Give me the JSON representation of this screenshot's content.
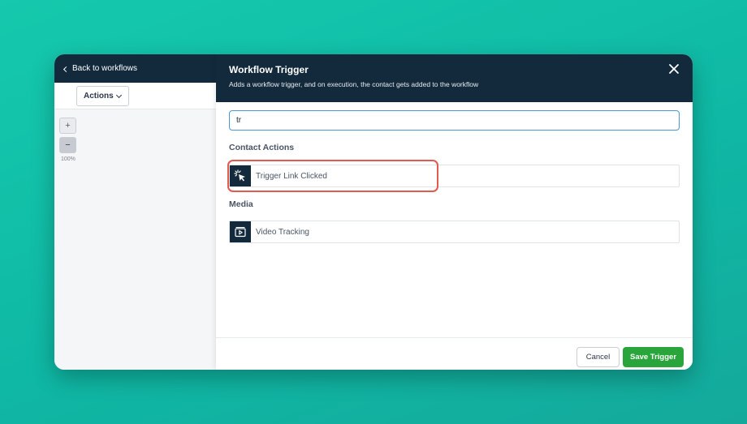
{
  "sidebar": {
    "back_label": "Back to workflows",
    "actions_label": "Actions",
    "zoom_in": "+",
    "zoom_out": "−",
    "zoom_level": "100%"
  },
  "panel": {
    "title": "Workflow Trigger",
    "description": "Adds a workflow trigger, and on execution, the contact gets added to the workflow",
    "search_value": "tr",
    "sections": [
      {
        "label": "Contact Actions",
        "items": [
          {
            "label": "Trigger Link Clicked",
            "icon": "cursor-click-icon"
          }
        ]
      },
      {
        "label": "Media",
        "items": [
          {
            "label": "Video Tracking",
            "icon": "video-icon"
          }
        ]
      }
    ]
  },
  "footer": {
    "cancel_label": "Cancel",
    "save_label": "Save Trigger"
  },
  "colors": {
    "header_bg": "#132a3d",
    "accent_input": "#4a98d8",
    "save_button": "#2aa53b",
    "highlight": "#e05a4f"
  }
}
